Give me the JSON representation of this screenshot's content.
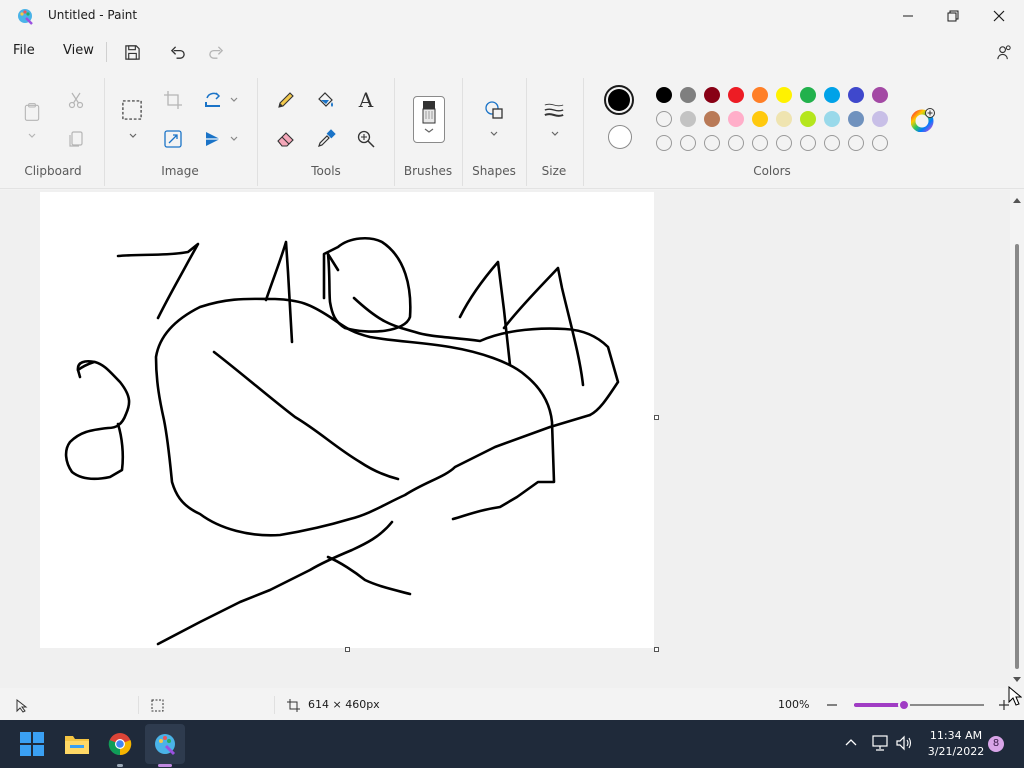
{
  "window": {
    "title": "Untitled - Paint"
  },
  "menu": {
    "file": "File",
    "view": "View"
  },
  "ribbon": {
    "groups": {
      "clipboard": "Clipboard",
      "image": "Image",
      "tools": "Tools",
      "brushes": "Brushes",
      "shapes": "Shapes",
      "size": "Size",
      "colors": "Colors"
    },
    "text_tool_glyph": "A",
    "palette_row1": [
      "#000000",
      "#7f7f7f",
      "#880015",
      "#ed1c24",
      "#ff7f27",
      "#fff200",
      "#22b14c",
      "#00a2e8",
      "#3f48cc",
      "#a349a4"
    ],
    "palette_row2": [
      "",
      "#c3c3c3",
      "#b97a57",
      "#ffaec9",
      "#ffc90e",
      "#efe4b0",
      "#b5e61d",
      "#99d9ea",
      "#7092be",
      "#c8bfe7"
    ],
    "primary_color": "#000000",
    "secondary_color": "#ffffff"
  },
  "status": {
    "canvas_size": "614 × 460px",
    "zoom": "100%",
    "zoom_level": 0.5
  },
  "taskbar": {
    "time": "11:34 AM",
    "date": "3/21/2022",
    "notification_count": "8"
  }
}
